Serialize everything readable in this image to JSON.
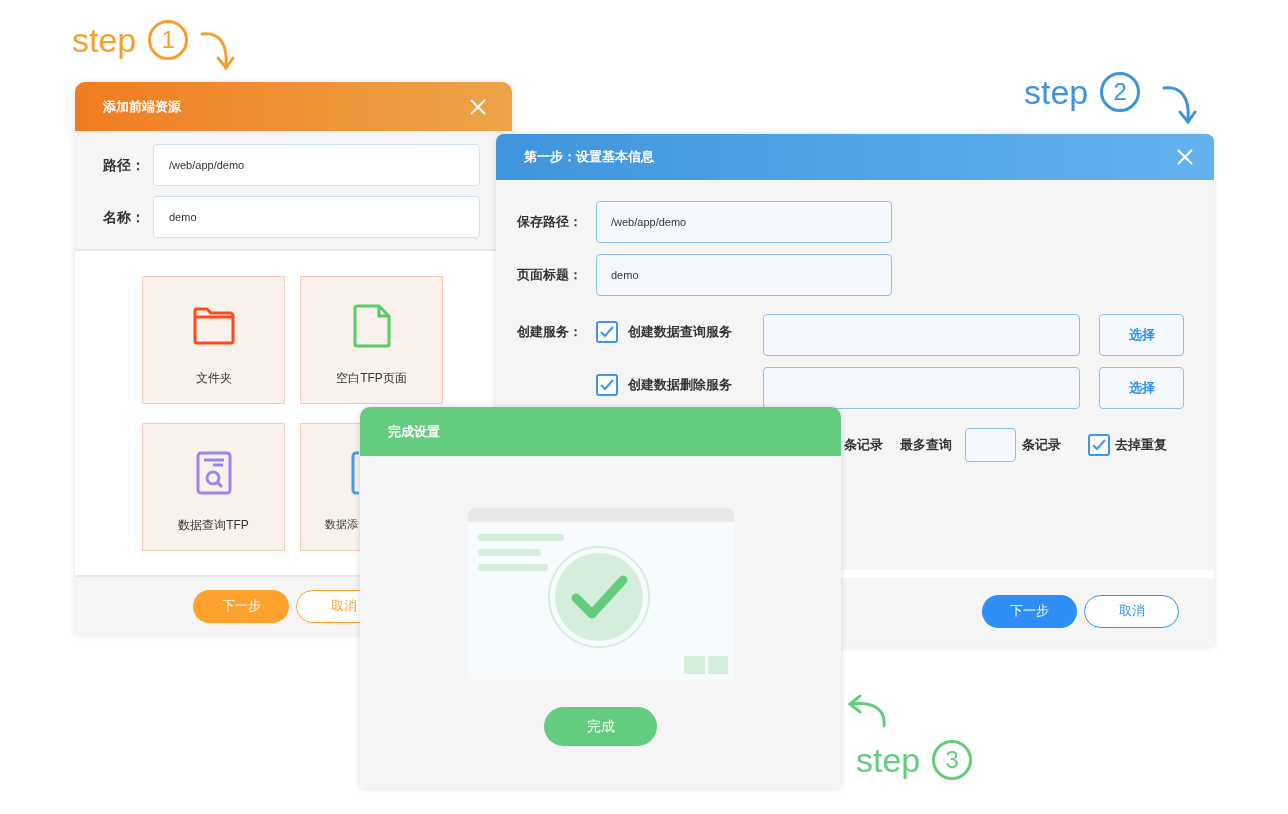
{
  "steps": [
    {
      "text": "step",
      "number": "1",
      "color": "#f5a02d"
    },
    {
      "text": "step",
      "number": "2",
      "color": "#3d94dc"
    },
    {
      "text": "step",
      "number": "3",
      "color": "#63cc7f"
    }
  ],
  "add_resource_dialog": {
    "title": "添加前端资源",
    "fields": [
      {
        "label": "路径：",
        "value": "/web/app/demo"
      },
      {
        "label": "名称：",
        "value": "demo"
      }
    ],
    "tiles": [
      {
        "kind": "folder",
        "label": "文件夹"
      },
      {
        "kind": "blank_page",
        "label": "空白TFP页面"
      },
      {
        "kind": "query",
        "label": "数据查询TFP"
      },
      {
        "kind": "add",
        "label": "数据添"
      }
    ],
    "buttons": [
      {
        "label": "下一步",
        "kind": "primary"
      },
      {
        "label": "取消",
        "kind": "outline"
      }
    ]
  },
  "basic_info_dialog": {
    "title": "第一步：设置基本信息",
    "fields": [
      {
        "label": "保存路径：",
        "value": "/web/app/demo"
      },
      {
        "label": "页面标题：",
        "value": "demo"
      }
    ],
    "services_label": "创建服务：",
    "services": [
      {
        "label": "创建数据查询服务",
        "checked": true,
        "button": "选择"
      },
      {
        "label": "创建数据删除服务",
        "checked": true,
        "button": "选择"
      }
    ],
    "limits": {
      "min_suffix": "条记录",
      "max_label": "最多查询",
      "max_suffix": "条记录",
      "dedupe": {
        "label": "去掉重复",
        "checked": true
      }
    },
    "buttons": [
      {
        "label": "下一步",
        "kind": "primary"
      },
      {
        "label": "取消",
        "kind": "outline"
      }
    ]
  },
  "complete_dialog": {
    "title": "完成设置",
    "button": "完成"
  }
}
